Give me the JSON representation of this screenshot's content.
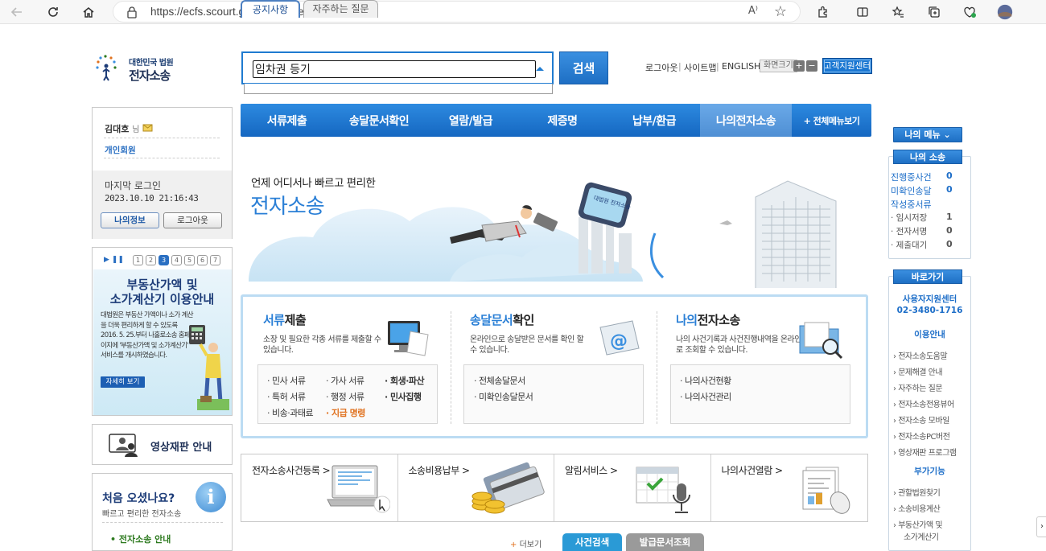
{
  "browser": {
    "url": "https://ecfs.scourt.go.kr/ecf/index.jsp",
    "reader_label": "A⁾"
  },
  "header": {
    "logo_line1": "대한민국 법원",
    "logo_line2": "전자소송",
    "search_value": "임차권 등기",
    "search_button": "검색",
    "util_links": [
      "로그아웃",
      "사이트맵",
      "ENGLISH"
    ],
    "font_size_label": "화면크기",
    "font_plus": "+",
    "font_minus": "−",
    "customer_center": "고객지원센터"
  },
  "nav": {
    "items": [
      "서류제출",
      "송달문서확인",
      "열람/발급",
      "제증명",
      "납부/환급",
      "나의전자소송"
    ],
    "all_menu": "+ 전체메뉴보기",
    "active_index": 5
  },
  "user": {
    "name": "김대호",
    "honorific": "님",
    "member_type": "개인회원",
    "last_login_label": "마지막 로그인",
    "last_login_time": "2023.10.10 21:16:43",
    "info_button": "나의정보",
    "logout_button": "로그아웃"
  },
  "promo": {
    "pages": [
      "1",
      "2",
      "3",
      "4",
      "5",
      "6",
      "7"
    ],
    "active_page": 2,
    "title1": "부동산가액 및",
    "title2": "소가계산기 이용안내",
    "desc": "대법원은 부동산 가액이나 소가 계산을 더욱 편리하게 할 수 있도록 2016. 5. 25.부터 나홀로소송 홈페이지에 '부동산가액 및 소가계산기' 서비스를 개시하였습니다.",
    "more": "자세히 보기"
  },
  "video": {
    "label": "영상재판 안내"
  },
  "first_visit": {
    "title": "처음 오셨나요?",
    "subtitle": "빠르고 편리한 전자소송",
    "link": "• 전자소송 안내",
    "icon_char": "i"
  },
  "banner": {
    "line1": "언제 어디서나 빠르고 편리한",
    "line2": "전자소송",
    "screen_text": "대법원 전자소송"
  },
  "services": [
    {
      "title_blue": "서류",
      "title_rest": "제출",
      "desc": "소장 및 필요한 각종 서류를 제출할 수 있습니다.",
      "links": [
        "· 민사 서류",
        "· 가사 서류",
        "· 회생·파산",
        "· 특허 서류",
        "· 행정 서류",
        "· 민사집행",
        "· 비송·과태료",
        "· 지급 명령"
      ]
    },
    {
      "title_blue": "송달문서",
      "title_rest": "확인",
      "desc": "온라인으로 송달받은 문서를 확인 할 수 있습니다.",
      "links": [
        "· 전체송달문서",
        "· 미확인송달문서"
      ]
    },
    {
      "title_blue": "나의",
      "title_rest": "전자소송",
      "desc": "나의 사건기록과 사건진행내역을 온라인으로 조회할 수 있습니다.",
      "links": [
        "· 나의사건현황",
        "· 나의사건관리"
      ]
    }
  ],
  "quick": [
    {
      "label": "전자소송사건등록 >"
    },
    {
      "label": "소송비용납부 >"
    },
    {
      "label": "알림서비스 >"
    },
    {
      "label": "나의사건열람 >"
    }
  ],
  "bottom": {
    "tab_notice": "공지사항",
    "tab_faq": "자주하는 질문",
    "more": "더보기",
    "case_search": "사건검색",
    "doc_search": "발급문서조회"
  },
  "right": {
    "my_menu": "나의 메뉴",
    "my_case_head": "나의 소송",
    "rows": [
      {
        "label": "진행중사건",
        "value": "0"
      },
      {
        "label": "미확인송달",
        "value": "0"
      },
      {
        "label": "작성중서류",
        "value": ""
      },
      {
        "label": "· 임시저장",
        "value": "1"
      },
      {
        "label": "· 전자서명",
        "value": "0"
      },
      {
        "label": "· 제출대기",
        "value": "0"
      }
    ],
    "shortcut_head": "바로가기",
    "center_name": "사용자지원센터",
    "center_phone": "02-3480-1716",
    "usage_head": "이용안내",
    "usage_links": [
      "전자소송도움말",
      "문제해결 안내",
      "자주하는 질문",
      "전자소송전용뷰어",
      "전자소송 모바일",
      "전자소송PC버전",
      "영상재판 프로그램"
    ],
    "extra_head": "부가기능",
    "extra_links": [
      "관할법원찾기",
      "소송비용계산",
      "부동산가액 및",
      "소가계산기"
    ]
  },
  "colors": {
    "primary": "#1e6fc4",
    "accent": "#e0711e",
    "link": "#1d6ec8"
  }
}
